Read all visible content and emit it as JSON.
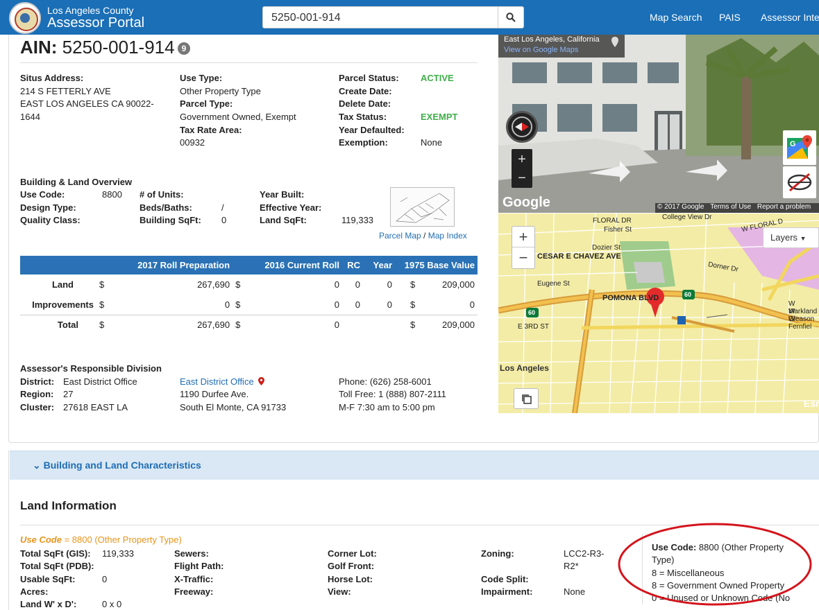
{
  "nav": {
    "brand_line1": "Los Angeles County",
    "brand_line2": "Assessor Portal",
    "search_value": "5250-001-914",
    "links": [
      "Map Search",
      "PAIS",
      "Assessor Inter"
    ]
  },
  "parcel": {
    "ain_label": "AIN:",
    "ain": "5250-001-914",
    "badge": "9",
    "situs_label": "Situs Address:",
    "situs_line1": "214 S FETTERLY AVE",
    "situs_line2": "EAST LOS ANGELES CA 90022-",
    "situs_line3": "1644",
    "use_type_label": "Use Type:",
    "use_type": "Other Property Type",
    "parcel_type_label": "Parcel Type:",
    "parcel_type": "Government Owned, Exempt",
    "tra_label": "Tax Rate Area:",
    "tra": "00932",
    "status_label": "Parcel Status:",
    "status": "ACTIVE",
    "create_label": "Create Date:",
    "delete_label": "Delete Date:",
    "tax_status_label": "Tax Status:",
    "tax_status": "EXEMPT",
    "defaulted_label": "Year Defaulted:",
    "exemption_label": "Exemption:",
    "exemption": "None"
  },
  "overview": {
    "title": "Building & Land Overview",
    "use_code_label": "Use Code:",
    "use_code": "8800",
    "design_label": "Design Type:",
    "quality_label": "Quality Class:",
    "units_label": "# of Units:",
    "beds_label": "Beds/Baths:",
    "beds": "/",
    "bldg_sqft_label": "Building SqFt:",
    "bldg_sqft": "0",
    "year_built_label": "Year Built:",
    "eff_year_label": "Effective Year:",
    "land_sqft_label": "Land SqFt:",
    "land_sqft": "119,333",
    "parcel_map": "Parcel Map",
    "sep": " / ",
    "map_index": "Map Index"
  },
  "values_table": {
    "headers": [
      "",
      "2017 Roll Preparation",
      "2016 Current Roll",
      "RC",
      "Year",
      "1975 Base Value"
    ],
    "rows": [
      {
        "label": "Land",
        "d1": "$",
        "v1": "267,690",
        "d2": "$",
        "v2": "0",
        "rc": "0",
        "year": "0",
        "d3": "$",
        "v3": "209,000"
      },
      {
        "label": "Improvements",
        "d1": "$",
        "v1": "0",
        "d2": "$",
        "v2": "0",
        "rc": "0",
        "year": "0",
        "d3": "$",
        "v3": "0"
      },
      {
        "label": "Total",
        "d1": "$",
        "v1": "267,690",
        "d2": "$",
        "v2": "0",
        "rc": "",
        "year": "",
        "d3": "$",
        "v3": "209,000"
      }
    ]
  },
  "division": {
    "title": "Assessor's Responsible Division",
    "district_label": "District:",
    "district": "East District Office",
    "region_label": "Region:",
    "region": "27",
    "cluster_label": "Cluster:",
    "cluster": "27618 EAST LA",
    "office_link": "East District Office",
    "address1": "1190 Durfee Ave.",
    "address2": "South El Monte, CA 91733",
    "phone": "Phone: (626) 258-6001",
    "tollfree": "Toll Free: 1 (888) 807-2111",
    "hours": "M-F 7:30 am to 5:00 pm"
  },
  "streetview": {
    "place": "East Los Angeles, California",
    "view_link": "View on Google Maps",
    "google": "Google",
    "copyright": "© 2017 Google",
    "terms": "Terms of Use",
    "report": "Report a problem"
  },
  "map": {
    "layers": "Layers",
    "zoom_in": "+",
    "zoom_out": "−",
    "labels": [
      "FLORAL DR",
      "College View Dr",
      "W FLORAL D",
      "Fisher St",
      "Dozier St",
      "CESAR E CHAVEZ AVE",
      "Dorner Dr",
      "Eugene St",
      "POMONA BLVD",
      "Los Angeles",
      "E 3RD ST",
      "W Markland",
      "W Gleason",
      "W Fernfiel",
      "60",
      "60",
      "Esri"
    ]
  },
  "section": {
    "title": "Building and Land Characteristics",
    "land_info": "Land Information",
    "use_code_link": "Use Code",
    "use_code_rest": " = 8800 (Other Property Type)",
    "total_gis_label": "Total SqFt (GIS):",
    "total_gis": "119,333",
    "total_pdb_label": "Total SqFt (PDB):",
    "usable_label": "Usable SqFt:",
    "usable": "0",
    "acres_label": "Acres:",
    "land_wd_label": "Land W' x D':",
    "land_wd": "0 x 0",
    "sewers_label": "Sewers:",
    "flight_label": "Flight Path:",
    "xtraffic_label": "X-Traffic:",
    "freeway_label": "Freeway:",
    "corner_label": "Corner Lot:",
    "golf_label": "Golf Front:",
    "horse_label": "Horse Lot:",
    "view_label": "View:",
    "zoning_label": "Zoning:",
    "zoning_1": "LCC2-R3-",
    "zoning_2": "R2*",
    "code_split_label": "Code Split:",
    "impairment_label": "Impairment:",
    "impairment": "None",
    "legend_label": "Use Code:",
    "legend_value1": " 8800 (Other Property",
    "legend_value2": "Type)",
    "legend_line1": "8 = Miscellaneous",
    "legend_line2": "8 = Government Owned Property",
    "legend_line3": "0 = Unused or Unknown Code (No"
  },
  "colors": {
    "nav": "#1a6fb7",
    "accent": "#1f6db5",
    "green": "#3fae49",
    "orange": "#e8941a",
    "annotation": "#d4141c"
  }
}
